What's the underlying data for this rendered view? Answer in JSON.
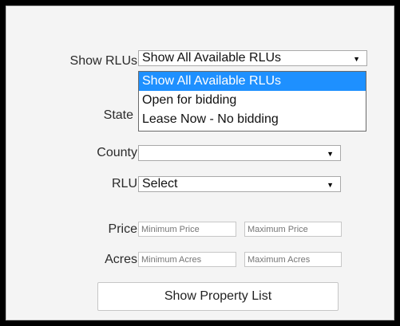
{
  "form": {
    "show_rlus_label": "Show RLUs",
    "show_rlus_value": "Show All Available RLUs",
    "show_rlus_options": [
      "Show All Available RLUs",
      "Open for bidding",
      "Lease Now - No bidding"
    ],
    "state_label": "State",
    "county_label": "County",
    "county_value": "",
    "rlu_label": "RLU",
    "rlu_value": "Select",
    "price_label": "Price",
    "price_min_placeholder": "Minimum Price",
    "price_max_placeholder": "Maximum Price",
    "acres_label": "Acres",
    "acres_min_placeholder": "Minimum Acres",
    "acres_max_placeholder": "Maximum Acres",
    "submit_label": "Show Property List"
  },
  "icons": {
    "dropdown_arrow": "▼"
  },
  "colors": {
    "highlight": "#1e90ff"
  }
}
